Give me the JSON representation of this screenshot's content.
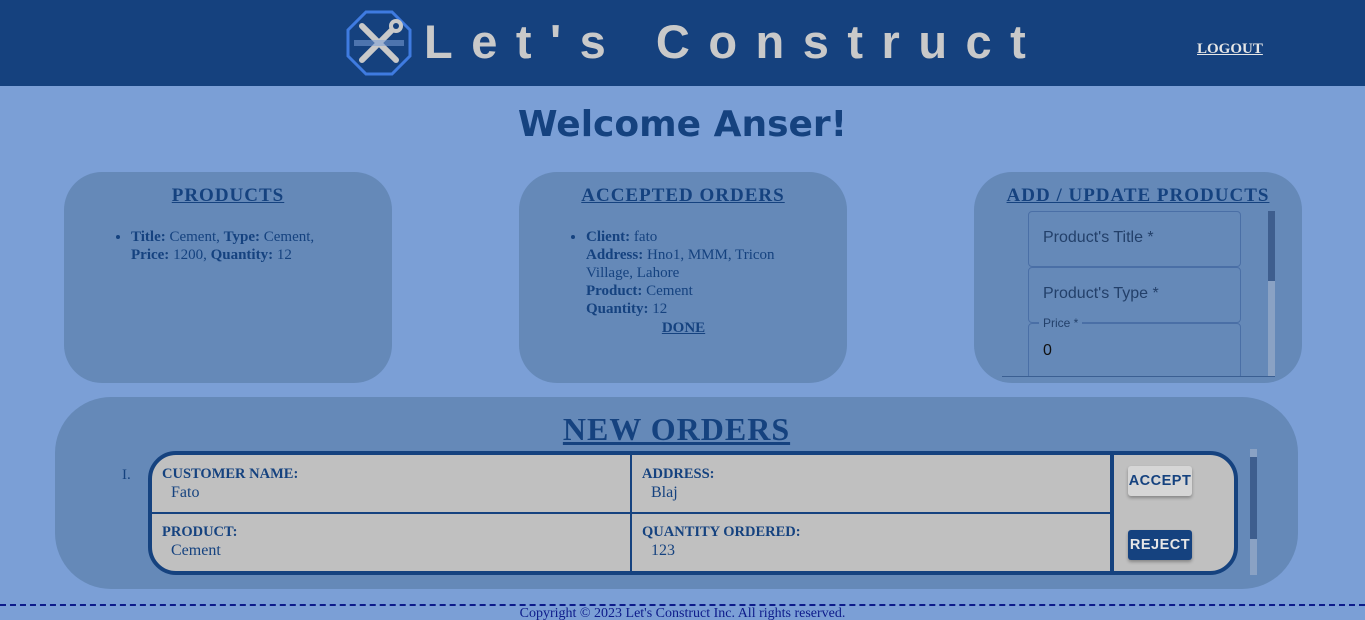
{
  "header": {
    "brand": "Let's Construct",
    "logout_label": "LOGOUT"
  },
  "welcome": "Welcome Anser!",
  "products": {
    "title": "PRODUCTS",
    "items": [
      {
        "title_key": "Title:",
        "title": "Cement,",
        "type_key": "Type:",
        "type": "Cement,",
        "price_key": "Price:",
        "price": "1200,",
        "qty_key": "Quantity:",
        "qty": "12"
      }
    ]
  },
  "accepted": {
    "title": "ACCEPTED ORDERS",
    "items": [
      {
        "client_key": "Client:",
        "client": "fato",
        "address_key": "Address:",
        "address": "Hno1, MMM, Tricon Village, Lahore",
        "product_key": "Product:",
        "product": "Cement",
        "qty_key": "Quantity:",
        "qty": "12",
        "done_label": "DONE"
      }
    ]
  },
  "add_update": {
    "title": "ADD / UPDATE PRODUCTS",
    "title_placeholder": "Product's Title *",
    "type_placeholder": "Product's Type *",
    "price_label": "Price *",
    "price_value": "0"
  },
  "new_orders": {
    "title": "NEW ORDERS",
    "index": "I.",
    "order": {
      "customer_key": "CUSTOMER NAME:",
      "customer": "Fato",
      "address_key": "ADDRESS:",
      "address": "Blaj",
      "product_key": "PRODUCT:",
      "product": "Cement",
      "qty_key": "QUANTITY ORDERED:",
      "qty": "123",
      "accept_label": "ACCEPT",
      "reject_label": "REJECT"
    }
  },
  "footer": "Copyright © 2023 Let's Construct Inc. All rights reserved.",
  "colors": {
    "header_bg": "#15417e",
    "page_bg": "#7b9fd6",
    "card_bg": "#6589b8",
    "text": "#15427f",
    "order_bg": "#c0c0c0"
  }
}
